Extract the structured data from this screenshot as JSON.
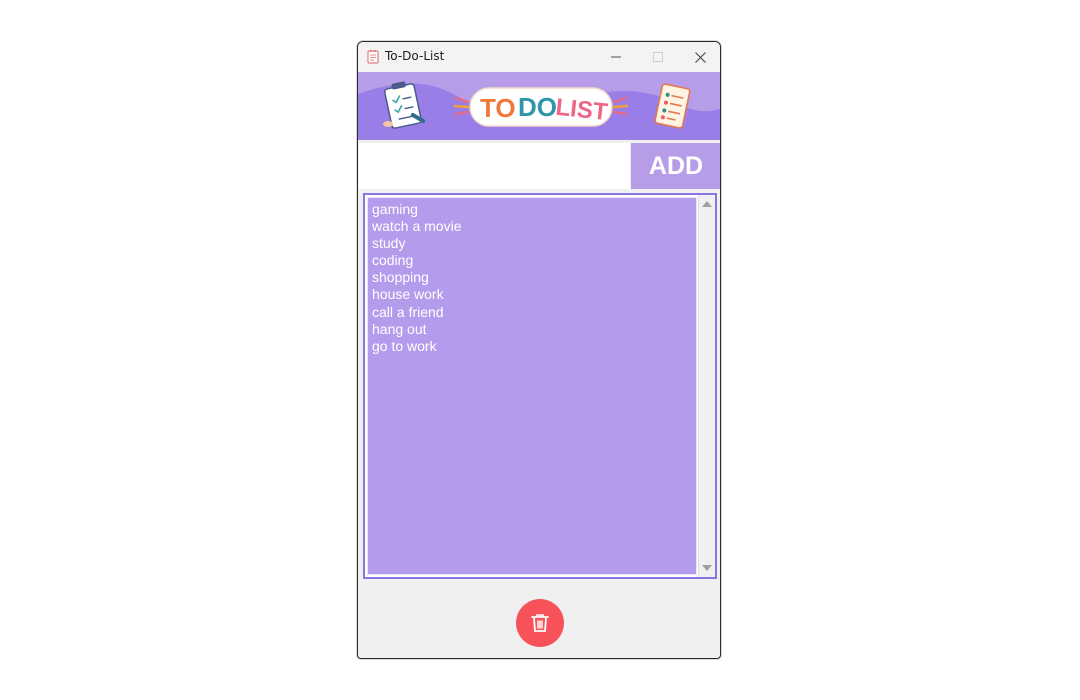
{
  "window": {
    "title": "To-Do-List",
    "icon": "notepad-icon",
    "controls": [
      "minimize-icon",
      "maximize-icon",
      "close-icon"
    ]
  },
  "banner": {
    "title_to": "TO",
    "title_do": "DO",
    "title_list": "LIST",
    "left_icon": "clipboard-checklist-icon",
    "right_icon": "notepad-list-icon"
  },
  "add_row": {
    "input_value": "",
    "button_label": "ADD"
  },
  "tasks": [
    "gaming",
    "watch a movie",
    "study",
    "coding",
    "shopping",
    "house work",
    "call a friend",
    "hang out",
    "go to work"
  ],
  "delete": {
    "icon": "trash-icon"
  },
  "colors": {
    "accent": "#b79ce8",
    "list_background": "#b59bec",
    "delete": "#f7525a",
    "list_border": "#8b73e6"
  }
}
